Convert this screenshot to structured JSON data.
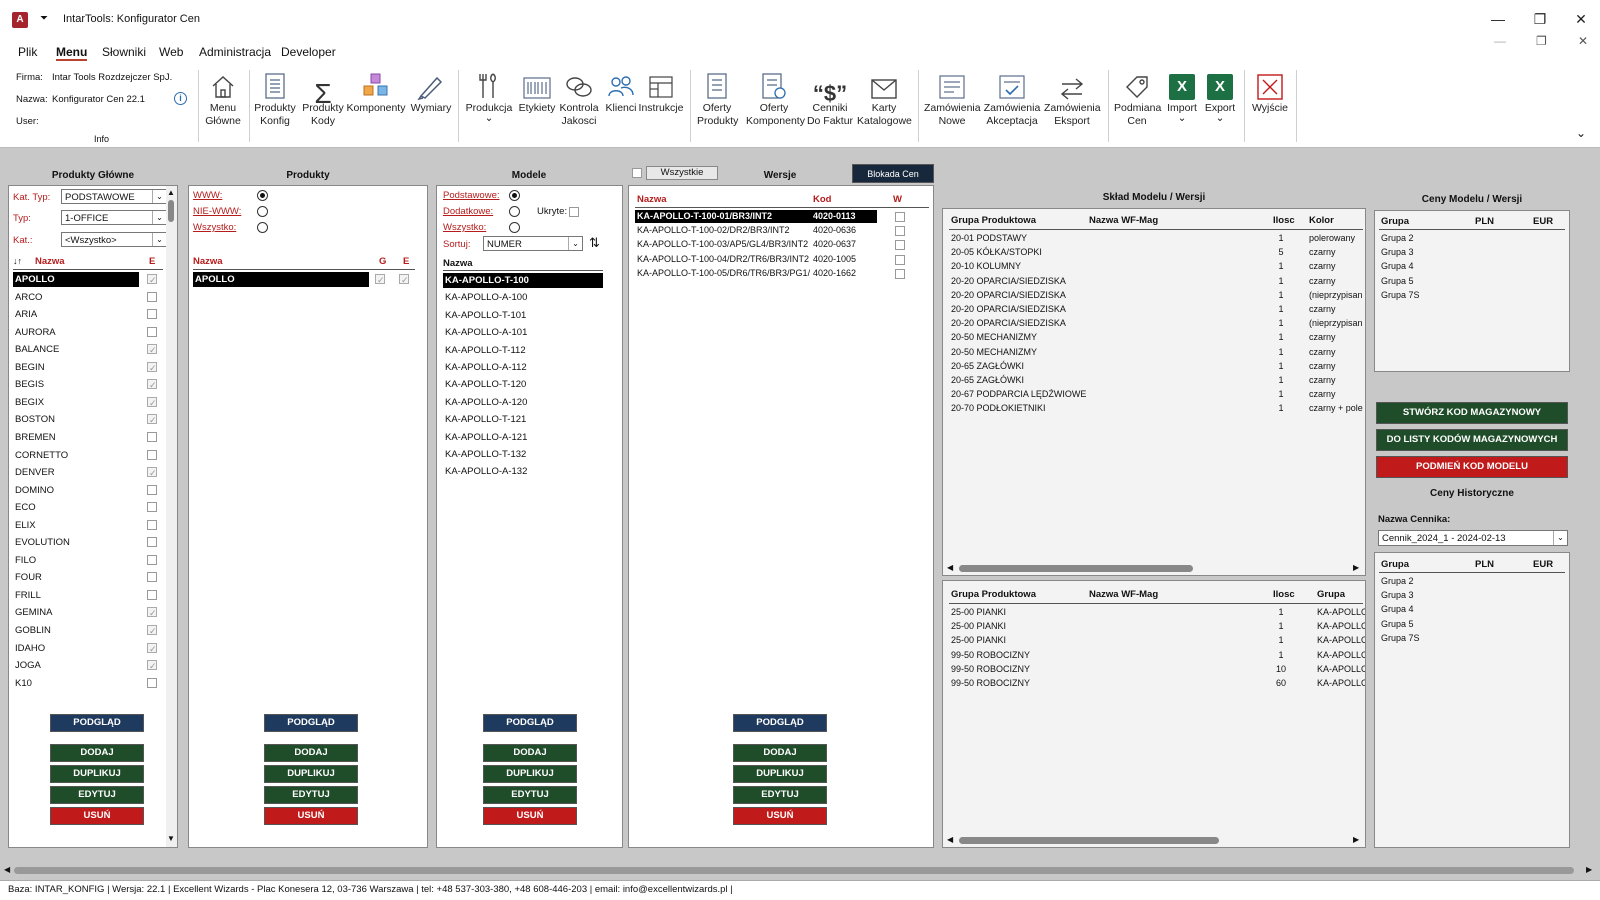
{
  "window": {
    "title": "IntarTools: Konfigurator Cen",
    "app_badge": "A",
    "qat": "⏷",
    "controls": [
      "—",
      "❐",
      "✕"
    ],
    "inner_controls": [
      "—",
      "❐",
      "✕"
    ]
  },
  "menu": [
    "Plik",
    "Menu",
    "Słowniki",
    "Web",
    "Administracja",
    "Developer"
  ],
  "info": {
    "firma_label": "Firma:",
    "firma": "Intar Tools Rozdzejczer SpJ.",
    "nazwa_label": "Nazwa:",
    "nazwa": "Konfigurator Cen 22.1",
    "user_label": "User:",
    "group": "Info"
  },
  "ribbon": {
    "menu_glowne": "Menu Główne",
    "produkty_konfig": "Produkty Konfig",
    "produkty_kody": "Produkty Kody",
    "komponenty": "Komponenty",
    "wymiary": "Wymiary",
    "produkcja": "Produkcja",
    "etykiety": "Etykiety",
    "kontrola": "Kontrola Jakosci",
    "klienci": "Klienci",
    "instrukcje": "Instrukcje",
    "oferty_produkty": "Oferty Produkty",
    "oferty_komponenty": "Oferty Komponenty",
    "cenniki": "Cenniki Do Faktur",
    "karty": "Karty Katalogowe",
    "zam_nowe": "Zamówienia Nowe",
    "zam_akcept": "Zamówienia Akceptacja",
    "zam_eksport": "Zamówienia Eksport",
    "podmiana": "Podmiana Cen",
    "import": "Import",
    "export": "Export",
    "wyjscie": "Wyjście",
    "dropdown": "⌄",
    "collapse": "⌄"
  },
  "produkty_glowne": {
    "title": "Produkty Główne",
    "kat_typ_label": "Kat. Typ:",
    "kat_typ": "PODSTAWOWE",
    "typ_label": "Typ:",
    "typ": "1-OFFICE",
    "kat_label": "Kat.:",
    "kat": "<Wszystko>",
    "sort_icon": "↓↑",
    "col_nazwa": "Nazwa",
    "col_e": "E",
    "items": [
      {
        "name": "APOLLO",
        "e": true,
        "sel": true
      },
      {
        "name": "ARCO",
        "e": false
      },
      {
        "name": "ARIA",
        "e": false
      },
      {
        "name": "AURORA",
        "e": false
      },
      {
        "name": "BALANCE",
        "e": true
      },
      {
        "name": "BEGIN",
        "e": true
      },
      {
        "name": "BEGIS",
        "e": true
      },
      {
        "name": "BEGIX",
        "e": true
      },
      {
        "name": "BOSTON",
        "e": true
      },
      {
        "name": "BREMEN",
        "e": false
      },
      {
        "name": "CORNETTO",
        "e": false
      },
      {
        "name": "DENVER",
        "e": true
      },
      {
        "name": "DOMINO",
        "e": false
      },
      {
        "name": "ECO",
        "e": false
      },
      {
        "name": "ELIX",
        "e": false
      },
      {
        "name": "EVOLUTION",
        "e": false
      },
      {
        "name": "FILO",
        "e": false
      },
      {
        "name": "FOUR",
        "e": false
      },
      {
        "name": "FRILL",
        "e": false
      },
      {
        "name": "GEMINA",
        "e": true
      },
      {
        "name": "GOBLIN",
        "e": true
      },
      {
        "name": "IDAHO",
        "e": true
      },
      {
        "name": "JOGA",
        "e": true
      },
      {
        "name": "K10",
        "e": false
      }
    ]
  },
  "produkty": {
    "title": "Produkty",
    "www": "WWW:",
    "nie_www": "NIE-WWW:",
    "wszystko": "Wszystko:",
    "col_nazwa": "Nazwa",
    "col_g": "G",
    "col_e": "E",
    "items": [
      {
        "name": "APOLLO",
        "g": true,
        "e": true
      }
    ]
  },
  "modele": {
    "title": "Modele",
    "podstawowe": "Podstawowe:",
    "dodatkowe": "Dodatkowe:",
    "ukryte": "Ukryte:",
    "wszystko": "Wszystko:",
    "sortuj_label": "Sortuj:",
    "sortuj": "NUMER",
    "sort_icon": "⇅",
    "col_nazwa": "Nazwa",
    "items": [
      "KA-APOLLO-T-100",
      "KA-APOLLO-A-100",
      "KA-APOLLO-T-101",
      "KA-APOLLO-A-101",
      "KA-APOLLO-T-112",
      "KA-APOLLO-A-112",
      "KA-APOLLO-T-120",
      "KA-APOLLO-A-120",
      "KA-APOLLO-T-121",
      "KA-APOLLO-A-121",
      "KA-APOLLO-T-132",
      "KA-APOLLO-A-132"
    ]
  },
  "wersje": {
    "wszystkie": "Wszystkie",
    "title": "Wersje",
    "blokada": "Blokada Cen",
    "col_nazwa": "Nazwa",
    "col_kod": "Kod",
    "col_w": "W",
    "items": [
      {
        "name": "KA-APOLLO-T-100-01/BR3/INT2",
        "kod": "4020-0113"
      },
      {
        "name": "KA-APOLLO-T-100-02/DR2/BR3/INT2",
        "kod": "4020-0636"
      },
      {
        "name": "KA-APOLLO-T-100-03/AP5/GL4/BR3/INT2",
        "kod": "4020-0637"
      },
      {
        "name": "KA-APOLLO-T-100-04/DR2/TR6/BR3/INT2",
        "kod": "4020-1005"
      },
      {
        "name": "KA-APOLLO-T-100-05/DR6/TR6/BR3/PG1/",
        "kod": "4020-1662"
      }
    ]
  },
  "sklad": {
    "title": "Skład Modelu / Wersji",
    "cols": [
      "Grupa Produktowa",
      "Nazwa WF-Mag",
      "Ilosc",
      "Kolor"
    ],
    "rows": [
      [
        "20-01 PODSTAWY",
        "",
        "1",
        "polerowany"
      ],
      [
        "20-05 KÓŁKA/STOPKI",
        "",
        "5",
        "czarny"
      ],
      [
        "20-10 KOLUMNY",
        "",
        "1",
        "czarny"
      ],
      [
        "20-20 OPARCIA/SIEDZISKA",
        "",
        "1",
        "czarny"
      ],
      [
        "20-20 OPARCIA/SIEDZISKA",
        "",
        "1",
        "(nieprzypisan"
      ],
      [
        "20-20 OPARCIA/SIEDZISKA",
        "",
        "1",
        "czarny"
      ],
      [
        "20-20 OPARCIA/SIEDZISKA",
        "",
        "1",
        "(nieprzypisan"
      ],
      [
        "20-50 MECHANIZMY",
        "",
        "1",
        "czarny"
      ],
      [
        "20-50 MECHANIZMY",
        "",
        "1",
        "czarny"
      ],
      [
        "20-65 ZAGŁÓWKI",
        "",
        "1",
        "czarny"
      ],
      [
        "20-65 ZAGŁÓWKI",
        "",
        "1",
        "czarny"
      ],
      [
        "20-67 PODPARCIA LĘDŹWIOWE",
        "",
        "1",
        "czarny"
      ],
      [
        "20-70 PODŁOKIETNIKI",
        "",
        "1",
        "czarny + pole"
      ]
    ],
    "cols2": [
      "Grupa Produktowa",
      "Nazwa WF-Mag",
      "Ilosc",
      "Grupa"
    ],
    "rows2": [
      [
        "25-00 PIANKI",
        "",
        "1",
        "KA-APOLLO"
      ],
      [
        "25-00 PIANKI",
        "",
        "1",
        "KA-APOLLO"
      ],
      [
        "25-00 PIANKI",
        "",
        "1",
        "KA-APOLLO"
      ],
      [
        "99-50 ROBOCIZNY",
        "",
        "1",
        "KA-APOLLO"
      ],
      [
        "99-50 ROBOCIZNY",
        "",
        "10",
        "KA-APOLLO"
      ],
      [
        "99-50 ROBOCIZNY",
        "",
        "60",
        "KA-APOLLO"
      ]
    ]
  },
  "ceny": {
    "title": "Ceny Modelu / Wersji",
    "cols": [
      "Grupa",
      "PLN",
      "EUR"
    ],
    "groups": [
      "Grupa 2",
      "Grupa 3",
      "Grupa 4",
      "Grupa 5",
      "Grupa 7S"
    ],
    "stworz": "STWÓRZ KOD MAGAZYNOWY",
    "do_listy": "DO LISTY KODÓW MAGAZYNOWYCH",
    "podmien": "PODMIEŃ KOD MODELU",
    "hist_title": "Ceny Historyczne",
    "cennik_label": "Nazwa Cennika:",
    "cennik": "Cennik_2024_1 - 2024-02-13",
    "hist_groups": [
      "Grupa 2",
      "Grupa 3",
      "Grupa 4",
      "Grupa 5",
      "Grupa 7S"
    ]
  },
  "buttons": {
    "podglad": "PODGLĄD",
    "dodaj": "DODAJ",
    "duplikuj": "DUPLIKUJ",
    "edytuj": "EDYTUJ",
    "usun": "USUŃ"
  },
  "status": "Baza: INTAR_KONFIG | Wersja: 22.1 | Excellent Wizards - Plac Konesera 12, 03-736 Warszawa | tel: +48 537-303-380, +48 608-446-203 | email: info@excellentwizards.pl |",
  "colors": {
    "accent": "#b5432e",
    "navy": "#1f3a5f",
    "green": "#1f4d2a",
    "red": "#c11a1a"
  }
}
